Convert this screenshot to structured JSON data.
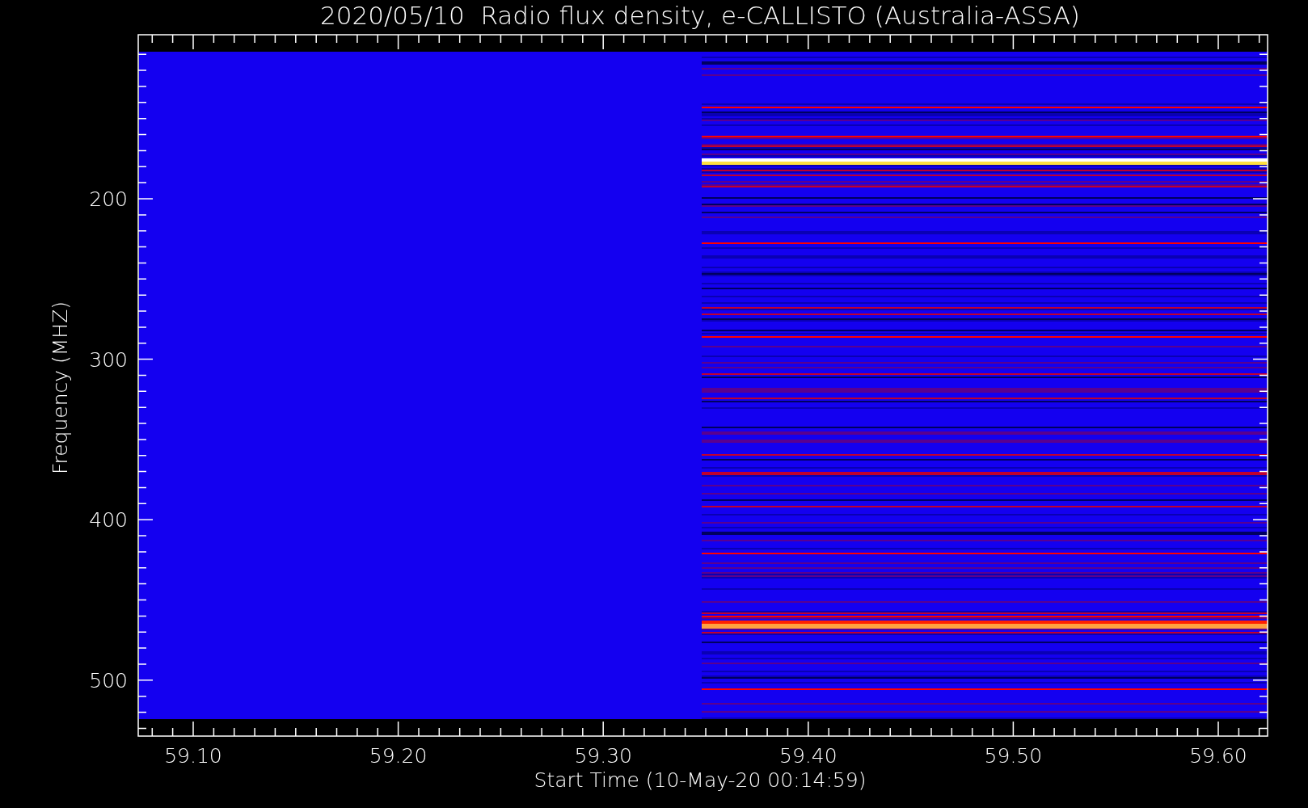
{
  "title": "2020/05/10  Radio flux density, e-CALLISTO (Australia-ASSA)",
  "y_axis": {
    "label": "Frequency (MHZ)",
    "tick_labels": [
      "200",
      "300",
      "400",
      "500"
    ]
  },
  "x_axis": {
    "label": "Start Time (10-May-20 00:14:59)",
    "tick_labels": [
      "59.10",
      "59.20",
      "59.30",
      "59.40",
      "59.50",
      "59.60"
    ]
  }
}
